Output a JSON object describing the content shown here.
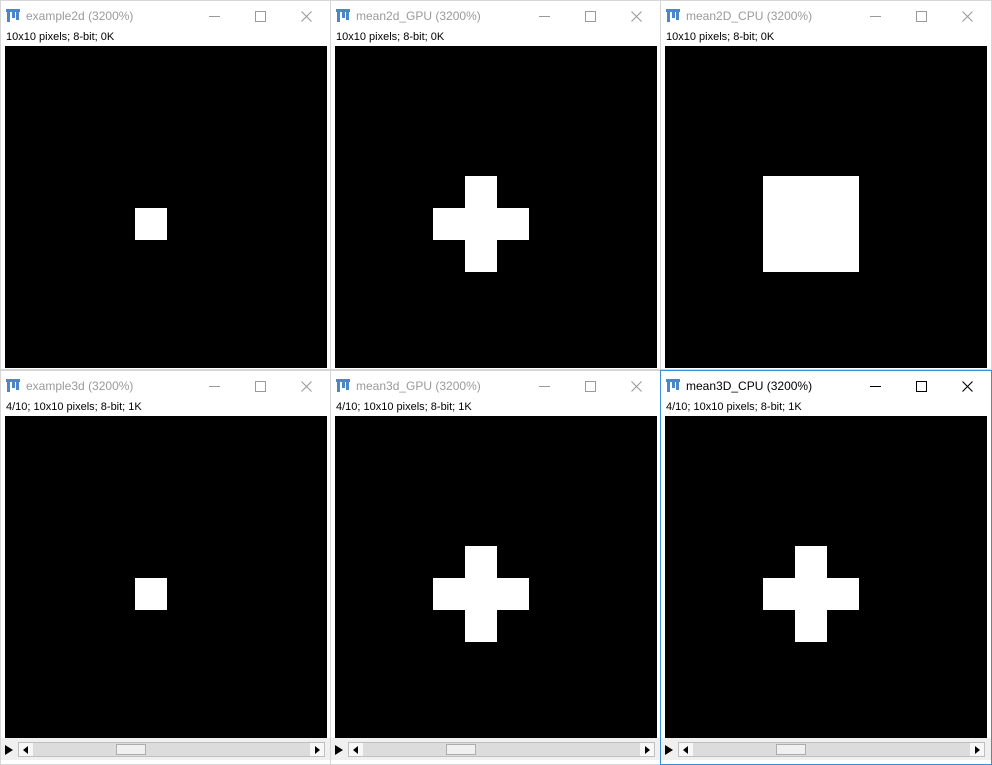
{
  "windows": [
    {
      "title": "example2d",
      "zoom": "(3200%)",
      "info": "10x10 pixels; 8-bit; 0K",
      "active": false,
      "has_slice_bar": false,
      "slice": null,
      "white_pixels": [
        [
          4,
          5
        ]
      ]
    },
    {
      "title": "mean2d_GPU",
      "zoom": "(3200%)",
      "info": "10x10 pixels; 8-bit; 0K",
      "active": false,
      "has_slice_bar": false,
      "slice": null,
      "white_pixels": [
        [
          4,
          4
        ],
        [
          3,
          5
        ],
        [
          4,
          5
        ],
        [
          5,
          5
        ],
        [
          4,
          6
        ]
      ]
    },
    {
      "title": "mean2D_CPU",
      "zoom": "(3200%)",
      "info": "10x10 pixels; 8-bit; 0K",
      "active": false,
      "has_slice_bar": false,
      "slice": null,
      "white_pixels": [
        [
          3,
          4
        ],
        [
          4,
          4
        ],
        [
          5,
          4
        ],
        [
          3,
          5
        ],
        [
          4,
          5
        ],
        [
          5,
          5
        ],
        [
          3,
          6
        ],
        [
          4,
          6
        ],
        [
          5,
          6
        ]
      ]
    },
    {
      "title": "example3d",
      "zoom": "(3200%)",
      "info": "4/10; 10x10 pixels; 8-bit; 1K",
      "active": false,
      "has_slice_bar": true,
      "slice": {
        "current": 4,
        "total": 10
      },
      "white_pixels": [
        [
          4,
          5
        ]
      ]
    },
    {
      "title": "mean3d_GPU",
      "zoom": "(3200%)",
      "info": "4/10; 10x10 pixels; 8-bit; 1K",
      "active": false,
      "has_slice_bar": true,
      "slice": {
        "current": 4,
        "total": 10
      },
      "white_pixels": [
        [
          4,
          4
        ],
        [
          3,
          5
        ],
        [
          4,
          5
        ],
        [
          5,
          5
        ],
        [
          4,
          6
        ]
      ]
    },
    {
      "title": "mean3D_CPU",
      "zoom": "(3200%)",
      "info": "4/10; 10x10 pixels; 8-bit; 1K",
      "active": true,
      "has_slice_bar": true,
      "slice": {
        "current": 4,
        "total": 10
      },
      "white_pixels": [
        [
          4,
          4
        ],
        [
          3,
          5
        ],
        [
          4,
          5
        ],
        [
          5,
          5
        ],
        [
          4,
          6
        ]
      ]
    }
  ],
  "icons": {
    "app": "imagej-icon",
    "minimize": "minimize-icon",
    "maximize": "maximize-icon",
    "close": "close-icon",
    "play": "play-icon",
    "scroll_left": "scroll-left-icon",
    "scroll_right": "scroll-right-icon"
  },
  "colors": {
    "active_border": "#3c8fd6",
    "inactive_title": "#9a9a9a",
    "active_title": "#000000",
    "image_background": "#000000",
    "image_foreground": "#ffffff",
    "app_icon": "#4a86c8"
  }
}
